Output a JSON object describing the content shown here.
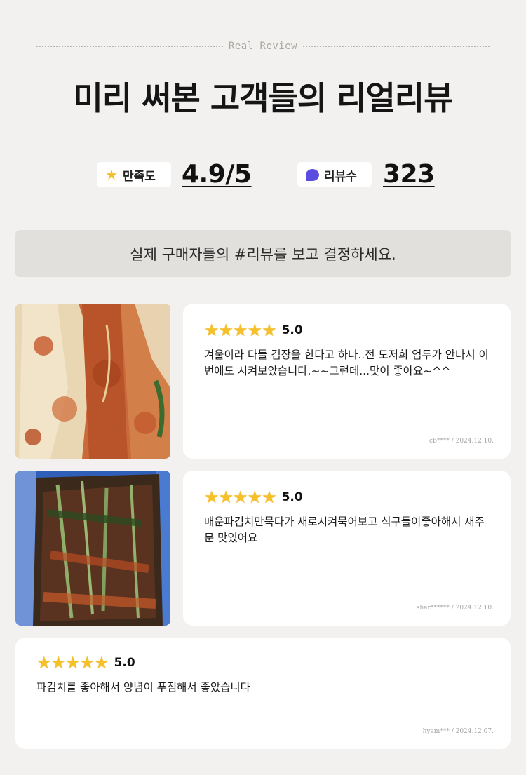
{
  "header": {
    "tag": "Real Review",
    "title": "미리 써본 고객들의 리얼리뷰"
  },
  "stats": {
    "satisfaction": {
      "label": "만족도",
      "value": "4.9/5",
      "icon": "star-icon"
    },
    "reviews": {
      "label": "리뷰수",
      "value": "323",
      "icon": "chat-bubble-icon"
    }
  },
  "banner": {
    "text": "실제 구매자들의 #리뷰를 보고 결정하세요."
  },
  "colors": {
    "star": "#f5c02a",
    "bubble": "#5b4ce0",
    "banner_bg": "#e2e0dc",
    "page_bg": "#f2f1ef"
  },
  "reviews": [
    {
      "stars": "★★★★★",
      "rating": 5.0,
      "score": "5.0",
      "text": "겨울이라 다들 김장을 한다고 하나..전 도저희 엄두가 안나서 이번에도 시켜보았습니다.~~그런데...맛이 좋아요~^^",
      "meta": "cb**** / 2024.12.10.",
      "photo": "kimchi-photo"
    },
    {
      "stars": "★★★★★",
      "rating": 5.0,
      "score": "5.0",
      "text": "매운파김치만묵다가 새로시켜묵어보고 식구들이좋아해서 재주문 맛있어요",
      "meta": "shar****** / 2024.12.10.",
      "photo": "green-onion-kimchi-photo"
    },
    {
      "stars": "★★★★★",
      "rating": 5.0,
      "score": "5.0",
      "text": "파김치를 좋아해서 양념이 푸짐해서 좋았습니다",
      "meta": "hyam*** / 2024.12.07."
    }
  ]
}
